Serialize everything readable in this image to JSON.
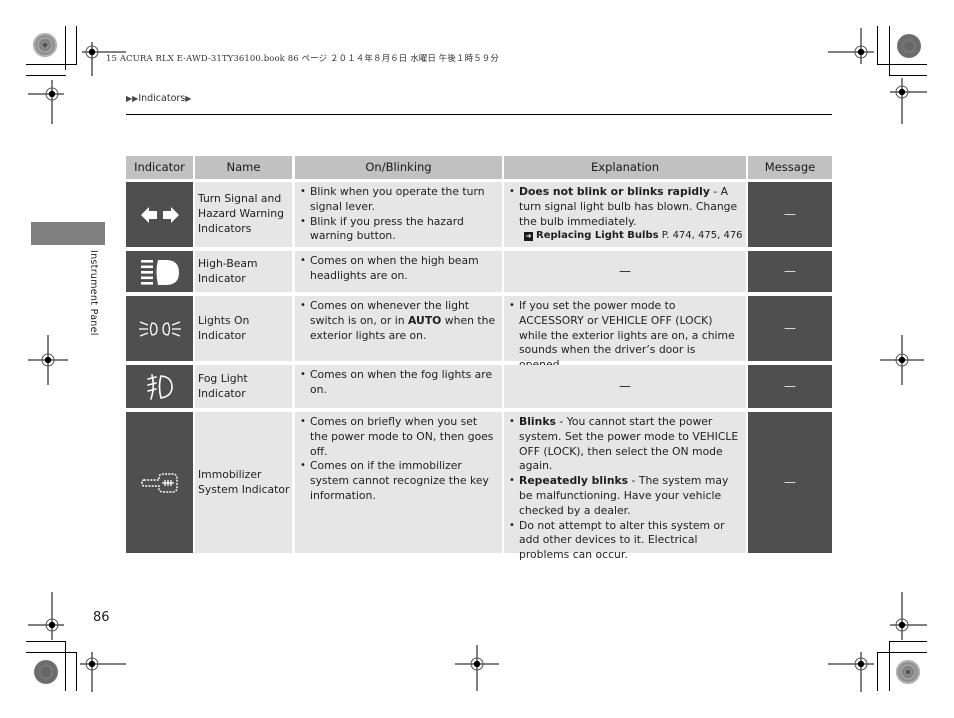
{
  "print_header": "15 ACURA RLX E-AWD-31TY36100.book  86 ページ  ２０１４年８月６日  水曜日  午後１時５９分",
  "breadcrumb": {
    "prefix_icon": "double-right-triangle-icon",
    "label": "Indicators",
    "suffix_icon": "right-triangle-icon"
  },
  "side_label": "Instrument Panel",
  "page_number": "86",
  "table": {
    "headers": [
      "Indicator",
      "Name",
      "On/Blinking",
      "Explanation",
      "Message"
    ],
    "rows": [
      {
        "icon": "turn-signal-arrows-icon",
        "name": "Turn Signal and Hazard Warning Indicators",
        "on_blinking": [
          "Blink when you operate the turn signal lever.",
          "Blink if you press the hazard warning button."
        ],
        "explanation": [
          {
            "bold": "Does not blink or blinks rapidly",
            "text": " - A turn signal light bulb has blown. Change the bulb immediately."
          }
        ],
        "xref": {
          "icon": "cross-reference-arrow-icon",
          "title": "Replacing Light Bulbs",
          "pages": " P. 474, 475, 476"
        },
        "message": "—"
      },
      {
        "icon": "high-beam-icon",
        "name": "High-Beam Indicator",
        "on_blinking": [
          "Comes on when the high beam headlights are on."
        ],
        "explanation_text": "—",
        "message": "—"
      },
      {
        "icon": "lights-on-icon",
        "name": "Lights On Indicator",
        "on_blinking_parts": {
          "before": "Comes on whenever the light switch is on, or in ",
          "bold": "AUTO",
          "after": " when the exterior lights are on."
        },
        "explanation": [
          {
            "bold": "",
            "text": "If you set the power mode to ACCESSORY or VEHICLE OFF (LOCK) while the exterior lights are on, a chime sounds when the driver’s door is opened."
          }
        ],
        "message": "—"
      },
      {
        "icon": "fog-light-icon",
        "name": "Fog Light Indicator",
        "on_blinking": [
          "Comes on when the fog lights are on."
        ],
        "explanation_text": "—",
        "message": "—"
      },
      {
        "icon": "immobilizer-key-icon",
        "name": "Immobilizer System Indicator",
        "on_blinking": [
          "Comes on briefly when you set the power mode to ON, then goes off.",
          "Comes on if the immobilizer system cannot recognize the key information."
        ],
        "explanation": [
          {
            "bold": "Blinks",
            "text": " - You cannot start the power system. Set the power mode to VEHICLE OFF (LOCK), then select the ON mode again."
          },
          {
            "bold": "Repeatedly blinks",
            "text": " - The system may be malfunctioning. Have your vehicle checked by a dealer."
          },
          {
            "bold": "",
            "text": "Do not attempt to alter this system or add other devices to it. Electrical problems can occur."
          }
        ],
        "message": "—"
      }
    ]
  }
}
